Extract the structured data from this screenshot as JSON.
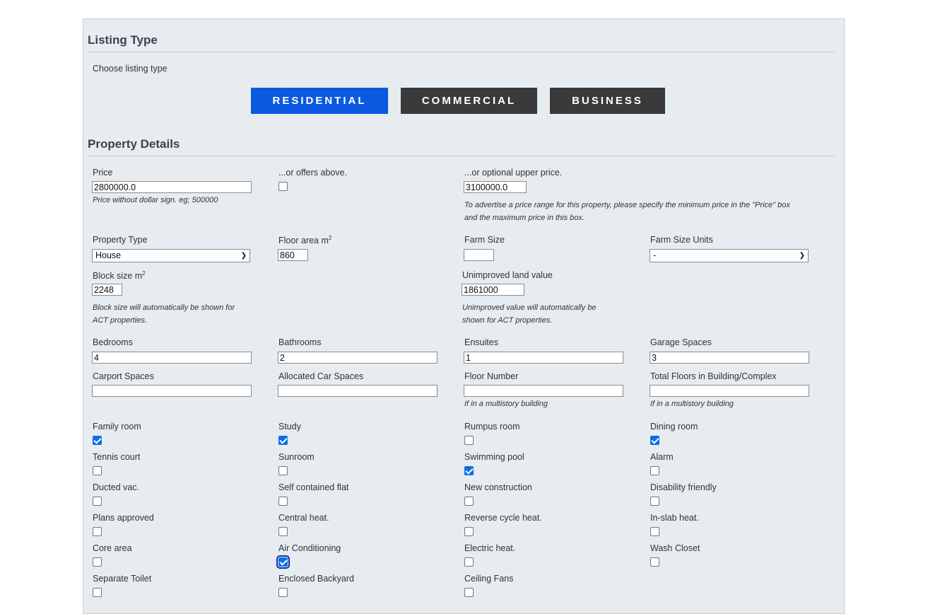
{
  "listing_type": {
    "heading": "Listing Type",
    "choose_label": "Choose listing type",
    "buttons": [
      "RESIDENTIAL",
      "COMMERCIAL",
      "BUSINESS"
    ],
    "selected": "RESIDENTIAL"
  },
  "property_details": {
    "heading": "Property Details",
    "price": {
      "label": "Price",
      "value": "2800000.0",
      "help": "Price without dollar sign. eg; 500000"
    },
    "offers_above": {
      "label": "...or offers above.",
      "checked": false
    },
    "upper_price": {
      "label": "...or optional upper price.",
      "value": "3100000.0",
      "help_line1": "To advertise a price range for this property, please specify the minimum price in the \"Price\" box",
      "help_line2": "and the maximum price in this box."
    },
    "property_type": {
      "label": "Property Type",
      "value": "House"
    },
    "floor_area": {
      "label": "Floor area m",
      "sup": "2",
      "value": "860"
    },
    "farm_size": {
      "label": "Farm Size",
      "value": ""
    },
    "farm_size_units": {
      "label": "Farm Size Units",
      "value": "-"
    },
    "block_size": {
      "label": "Block size m",
      "sup": "2",
      "value": "2248",
      "help_line1": "Block size will automatically be shown for",
      "help_line2": "ACT properties."
    },
    "unimproved_land_value": {
      "label": "Unimproved land value",
      "value": "1861000",
      "help_line1": "Unimproved value will automatically be",
      "help_line2": "shown for ACT properties."
    },
    "bedrooms": {
      "label": "Bedrooms",
      "value": "4"
    },
    "bathrooms": {
      "label": "Bathrooms",
      "value": "2"
    },
    "ensuites": {
      "label": "Ensuites",
      "value": "1"
    },
    "garage_spaces": {
      "label": "Garage Spaces",
      "value": "3"
    },
    "carport_spaces": {
      "label": "Carport Spaces",
      "value": ""
    },
    "allocated_car_spaces": {
      "label": "Allocated Car Spaces",
      "value": ""
    },
    "floor_number": {
      "label": "Floor Number",
      "value": "",
      "help": "If in a multistory building"
    },
    "total_floors": {
      "label": "Total Floors in Building/Complex",
      "value": "",
      "help": "If in a multistory building"
    },
    "features": [
      {
        "label": "Family room",
        "checked": true
      },
      {
        "label": "Study",
        "checked": true
      },
      {
        "label": "Rumpus room",
        "checked": false
      },
      {
        "label": "Dining room",
        "checked": true
      },
      {
        "label": "Tennis court",
        "checked": false
      },
      {
        "label": "Sunroom",
        "checked": false
      },
      {
        "label": "Swimming pool",
        "checked": true
      },
      {
        "label": "Alarm",
        "checked": false
      },
      {
        "label": "Ducted vac.",
        "checked": false
      },
      {
        "label": "Self contained flat",
        "checked": false
      },
      {
        "label": "New construction",
        "checked": false
      },
      {
        "label": "Disability friendly",
        "checked": false
      },
      {
        "label": "Plans approved",
        "checked": false
      },
      {
        "label": "Central heat.",
        "checked": false
      },
      {
        "label": "Reverse cycle heat.",
        "checked": false
      },
      {
        "label": "In-slab heat.",
        "checked": false
      },
      {
        "label": "Core area",
        "checked": false
      },
      {
        "label": "Air Conditioning",
        "checked": true,
        "focused": true
      },
      {
        "label": "Electric heat.",
        "checked": false
      },
      {
        "label": "Wash Closet",
        "checked": false
      },
      {
        "label": "Separate Toilet",
        "checked": false
      },
      {
        "label": "Enclosed Backyard",
        "checked": false
      },
      {
        "label": "Ceiling Fans",
        "checked": false
      }
    ]
  },
  "colors": {
    "selected_button": "#0a59e0",
    "button": "#3a3a3a",
    "panel": "#e6ecef",
    "checkbox_checked": "#0b6fe8"
  }
}
